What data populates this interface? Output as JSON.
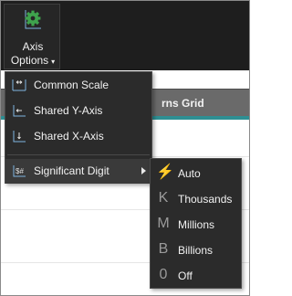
{
  "toolbar": {
    "axis_options_line1": "Axis",
    "axis_options_line2": "Options",
    "caret": "▾",
    "gear_icon": "gear-icon",
    "accent": "#3fa34d"
  },
  "background": {
    "grid_label_partial": "rns Grid"
  },
  "menu": {
    "items": [
      {
        "label": "Common Scale",
        "icon": "common-scale-icon"
      },
      {
        "label": "Shared Y-Axis",
        "icon": "shared-y-axis-icon"
      },
      {
        "label": "Shared X-Axis",
        "icon": "shared-x-axis-icon"
      },
      {
        "label": "Significant Digit",
        "icon": "significant-digit-icon"
      }
    ]
  },
  "submenu": {
    "items": [
      {
        "glyph": "⚡",
        "label": "Auto",
        "icon": "lightning-icon",
        "color": "#f0a030"
      },
      {
        "glyph": "K",
        "label": "Thousands",
        "icon": "thousands-icon"
      },
      {
        "glyph": "M",
        "label": "Millions",
        "icon": "millions-icon"
      },
      {
        "glyph": "B",
        "label": "Billions",
        "icon": "billions-icon"
      },
      {
        "glyph": "0",
        "label": "Off",
        "icon": "off-icon"
      }
    ]
  },
  "colors": {
    "menu_bg": "#2b2b2b",
    "topbar_bg": "#1e1e1e",
    "teal": "#2e8f93",
    "icon_blue": "#7fb4e0"
  }
}
